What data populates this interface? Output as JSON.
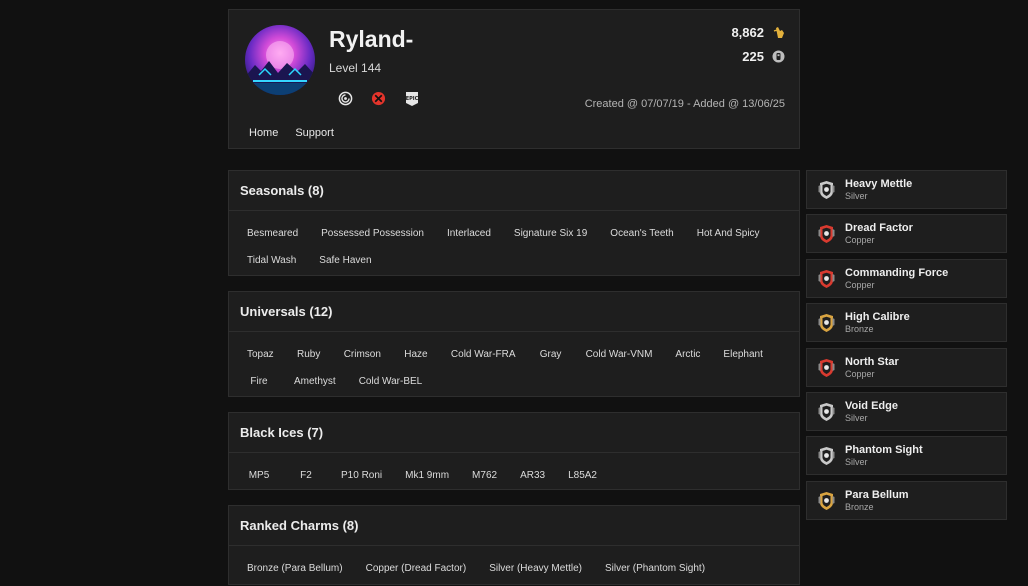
{
  "profile": {
    "username": "Ryland-",
    "level": "Level 144",
    "platforms": [
      "ubisoft-icon",
      "xbox-icon",
      "epic-icon"
    ],
    "stats": [
      {
        "value": "8,862",
        "icon": "renown-hand-icon"
      },
      {
        "value": "225",
        "icon": "r6-credits-coin-icon"
      }
    ],
    "dates": "Created @ 07/07/19 - Added @ 13/06/25",
    "nav": [
      "Home",
      "Support"
    ]
  },
  "sections": {
    "seasonals": {
      "title": "Seasonals (8)",
      "items": [
        "Besmeared",
        "Possessed Possession",
        "Interlaced",
        "Signature Six 19",
        "Ocean's Teeth",
        "Hot And Spicy",
        "Tidal Wash",
        "Safe Haven"
      ]
    },
    "universals": {
      "title": "Universals (12)",
      "items": [
        "Topaz",
        "Ruby",
        "Crimson",
        "Haze",
        "Cold War-FRA",
        "Gray",
        "Cold War-VNM",
        "Arctic",
        "Elephant",
        "Fire",
        "Amethyst",
        "Cold War-BEL"
      ]
    },
    "black_ices": {
      "title": "Black Ices (7)",
      "items": [
        "MP5",
        "F2",
        "P10 Roni",
        "Mk1 9mm",
        "M762",
        "AR33",
        "L85A2"
      ]
    },
    "ranked_charms": {
      "title": "Ranked Charms (8)",
      "items": [
        "Bronze (Para Bellum)",
        "Copper (Dread Factor)",
        "Silver (Heavy Mettle)",
        "Silver (Phantom Sight)"
      ]
    }
  },
  "ranks": [
    {
      "season": "Heavy Mettle",
      "tier": "Silver",
      "color": "#c9c9c9"
    },
    {
      "season": "Dread Factor",
      "tier": "Copper",
      "color": "#d93a2f"
    },
    {
      "season": "Commanding Force",
      "tier": "Copper",
      "color": "#d93a2f"
    },
    {
      "season": "High Calibre",
      "tier": "Bronze",
      "color": "#d9a441"
    },
    {
      "season": "North Star",
      "tier": "Copper",
      "color": "#d93a2f"
    },
    {
      "season": "Void Edge",
      "tier": "Silver",
      "color": "#c9c9c9"
    },
    {
      "season": "Phantom Sight",
      "tier": "Silver",
      "color": "#c9c9c9"
    },
    {
      "season": "Para Bellum",
      "tier": "Bronze",
      "color": "#d9a441"
    }
  ]
}
